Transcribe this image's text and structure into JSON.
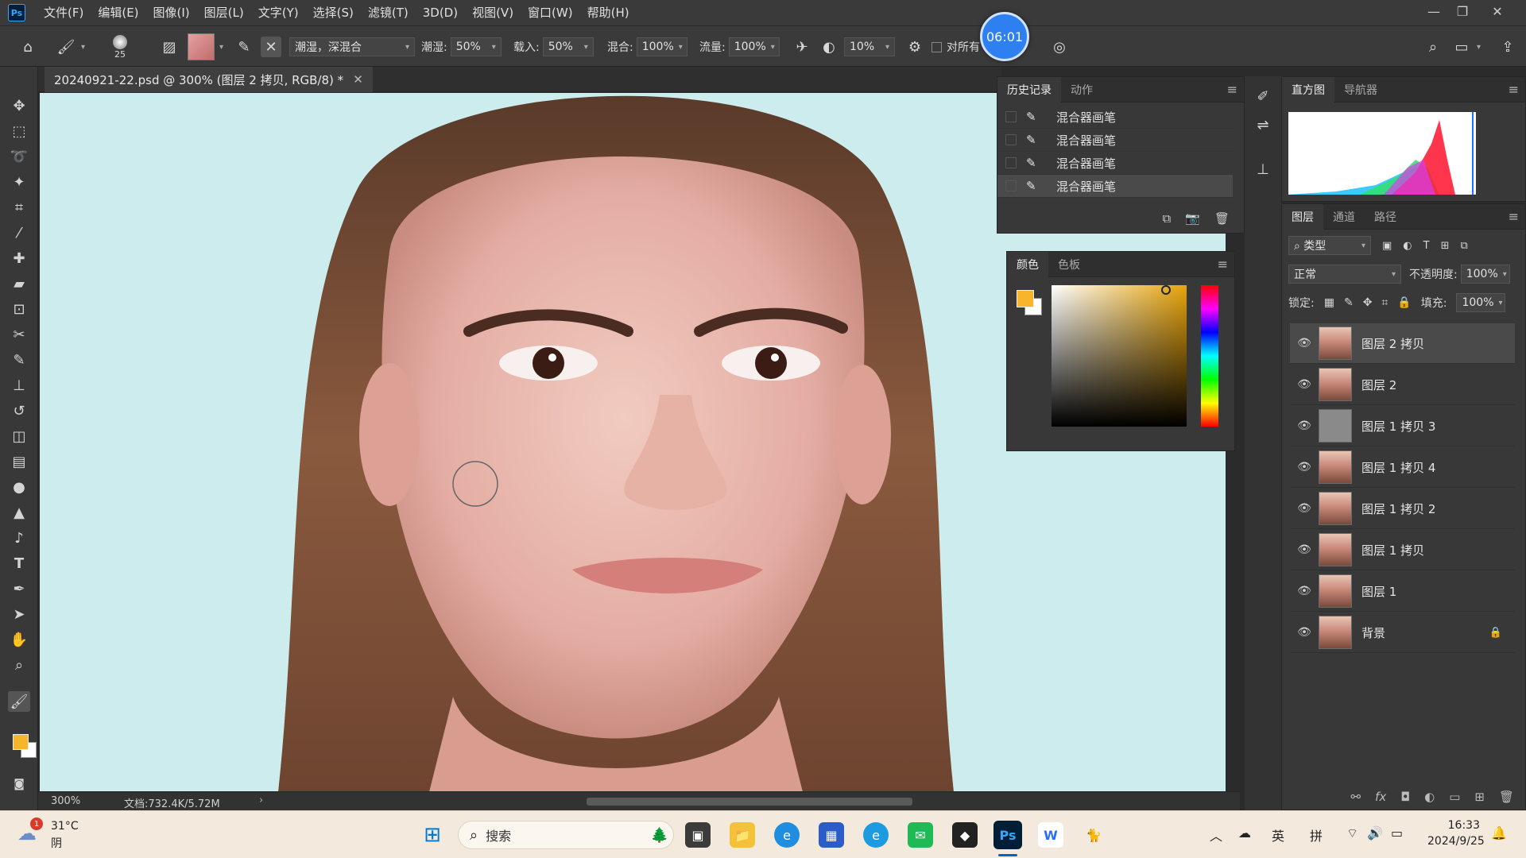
{
  "app": {
    "logo": "Ps"
  },
  "menu": [
    "文件(F)",
    "编辑(E)",
    "图像(I)",
    "图层(L)",
    "文字(Y)",
    "选择(S)",
    "滤镜(T)",
    "3D(D)",
    "视图(V)",
    "窗口(W)",
    "帮助(H)"
  ],
  "options": {
    "brush_size": "25",
    "blend_preset": "潮湿，深混合",
    "wet_label": "潮湿:",
    "wet_value": "50%",
    "load_label": "载入:",
    "load_value": "50%",
    "mix_label": "混合:",
    "mix_value": "100%",
    "flow_label": "流量:",
    "flow_value": "100%",
    "smoothing_value": "10%",
    "sample_all_label": "对所有"
  },
  "timer": "06:01",
  "document": {
    "tab_title": "20240921-22.psd @ 300% (图层 2 拷贝, RGB/8) *",
    "zoom": "300%",
    "doc_size": "文档:732.4K/5.72M"
  },
  "history_panel": {
    "tabs": [
      "历史记录",
      "动作"
    ],
    "items": [
      "混合器画笔",
      "混合器画笔",
      "混合器画笔",
      "混合器画笔"
    ]
  },
  "color_panel": {
    "tabs": [
      "颜色",
      "色板"
    ],
    "foreground": "#f6b52a",
    "background": "#ffffff"
  },
  "histogram_panel": {
    "tabs": [
      "直方图",
      "导航器"
    ]
  },
  "layers_panel": {
    "tabs": [
      "图层",
      "通道",
      "路径"
    ],
    "filter_kind": "类型",
    "blend_mode": "正常",
    "opacity_label": "不透明度:",
    "opacity_value": "100%",
    "lock_label": "锁定:",
    "fill_label": "填充:",
    "fill_value": "100%",
    "layers": [
      {
        "name": "图层 2 拷贝",
        "selected": true
      },
      {
        "name": "图层 2"
      },
      {
        "name": "图层 1 拷贝 3",
        "grey": true
      },
      {
        "name": "图层 1 拷贝 4"
      },
      {
        "name": "图层 1 拷贝 2"
      },
      {
        "name": "图层 1 拷贝"
      },
      {
        "name": "图层 1"
      },
      {
        "name": "背景",
        "locked": true
      }
    ]
  },
  "taskbar": {
    "weather_badge": "1",
    "temperature": "31°C",
    "weather": "阴",
    "search_placeholder": "搜索",
    "ime_lang": "英",
    "ime_mode": "拼",
    "time": "16:33",
    "date": "2024/9/25"
  }
}
